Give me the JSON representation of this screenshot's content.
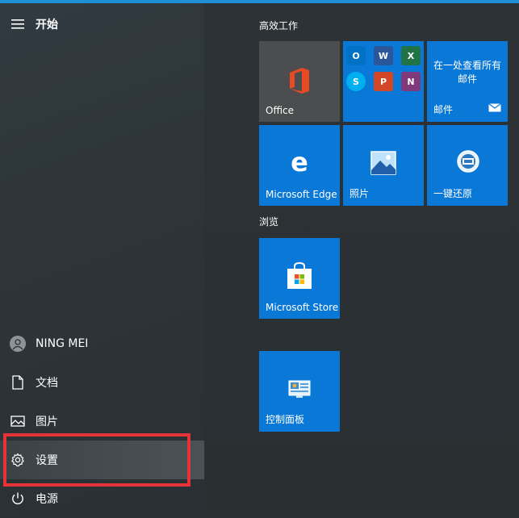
{
  "start_title": "开始",
  "user": {
    "name": "NING MEI"
  },
  "nav": {
    "documents": "文档",
    "pictures": "图片",
    "settings": "设置",
    "power": "电源"
  },
  "groups": {
    "productivity": "高效工作",
    "browse": "浏览"
  },
  "tiles": {
    "office": "Office",
    "mail_desc": "在一处查看所有邮件",
    "mail": "邮件",
    "edge": "Microsoft Edge",
    "photos": "照片",
    "restore": "一键还原",
    "store": "Microsoft Store",
    "control_panel": "控制面板"
  },
  "mini_apps": [
    {
      "letter": "O",
      "color": "#0072c6"
    },
    {
      "letter": "W",
      "color": "#2b579a"
    },
    {
      "letter": "X",
      "color": "#217346"
    },
    {
      "letter": "S",
      "color": "#00aff0"
    },
    {
      "letter": "P",
      "color": "#d24726"
    },
    {
      "letter": "N",
      "color": "#80397b"
    }
  ],
  "colors": {
    "tile_blue": "#0a78d7",
    "highlight": "#e63338"
  }
}
